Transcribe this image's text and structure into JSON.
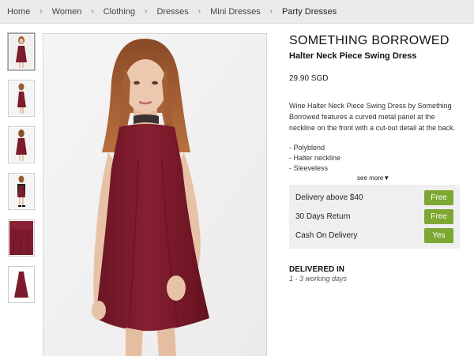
{
  "breadcrumb": {
    "items": [
      "Home",
      "Women",
      "Clothing",
      "Dresses",
      "Mini Dresses"
    ],
    "current": "Party Dresses",
    "separator": "›"
  },
  "product": {
    "brand": "SOMETHING BORROWED",
    "name": "Halter Neck Piece Swing Dress",
    "price": "29.90 SGD",
    "description": "Wine Halter Neck Piece Swing Dress by Something Borrowed features a curved metal panel at the neckline on the front with a cut-out detail at the back.",
    "features": [
      "- Polyblend",
      "- Halter neckline",
      "- Sleeveless"
    ],
    "see_more": "see more▼"
  },
  "perks": [
    {
      "label": "Delivery above $40",
      "badge": "Free"
    },
    {
      "label": "30 Days Return",
      "badge": "Free"
    },
    {
      "label": "Cash On Delivery",
      "badge": "Yes"
    }
  ],
  "delivery": {
    "heading": "DELIVERED IN",
    "days": "1 - 3 working days"
  },
  "colors": {
    "dress": "#7b1b2b",
    "badge": "#7ea734",
    "breadcrumb_bg": "#ebebeb"
  }
}
